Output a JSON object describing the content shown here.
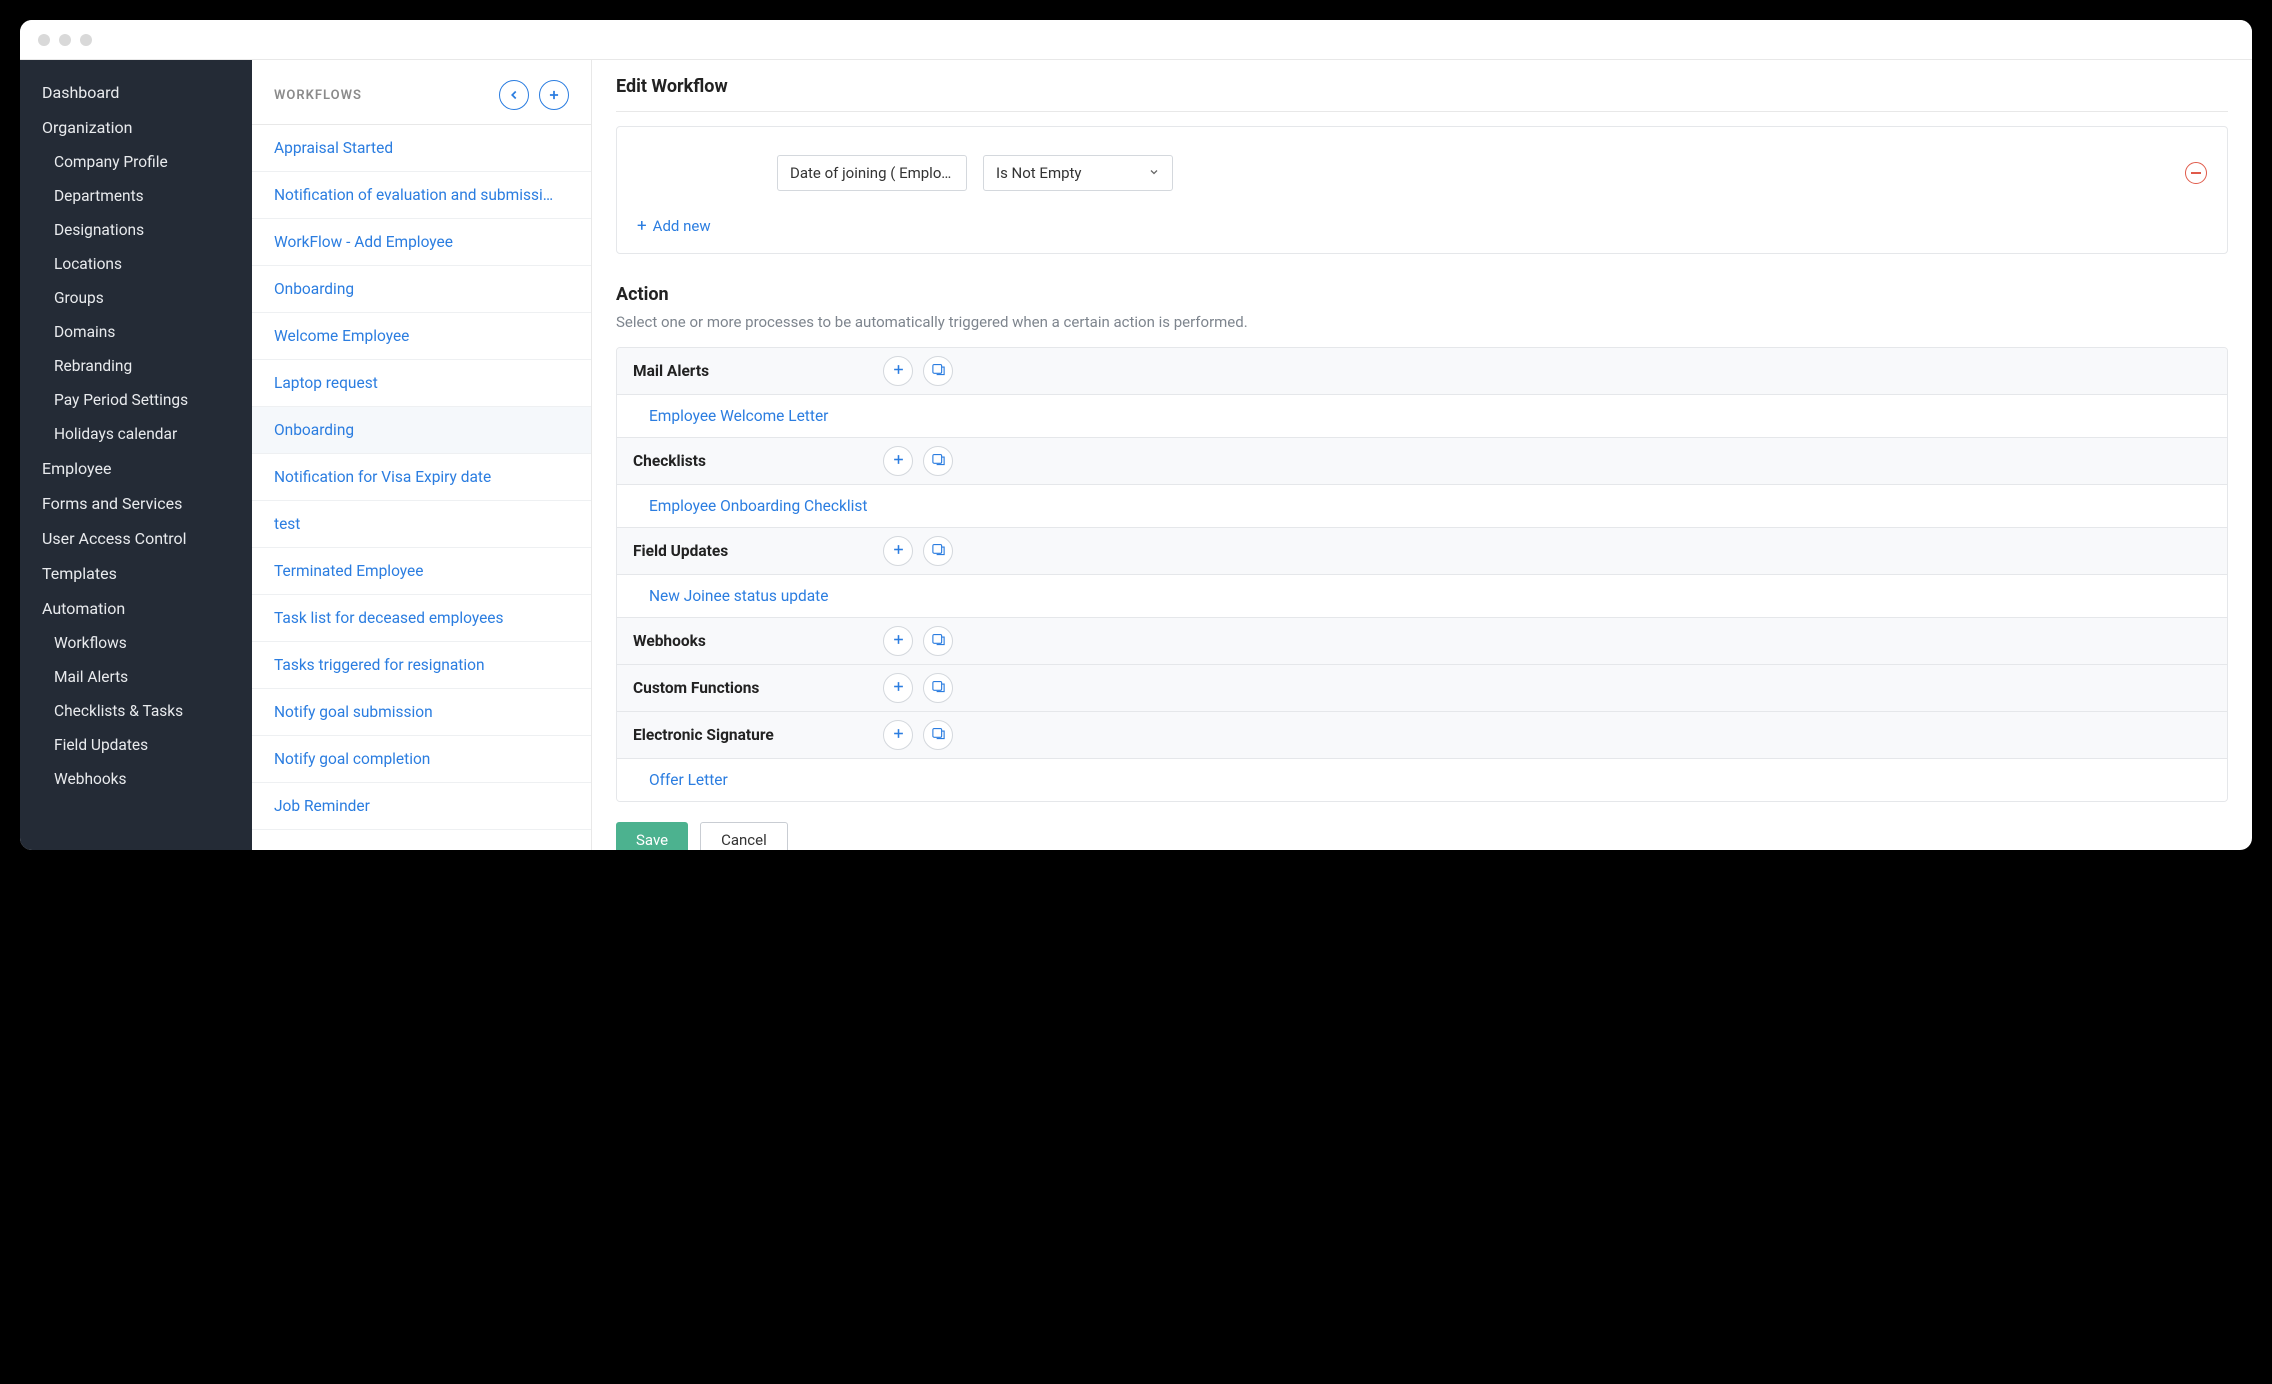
{
  "nav": {
    "items": [
      {
        "label": "Dashboard",
        "level": 0
      },
      {
        "label": "Organization",
        "level": 0
      },
      {
        "label": "Company Profile",
        "level": 1
      },
      {
        "label": "Departments",
        "level": 1
      },
      {
        "label": "Designations",
        "level": 1
      },
      {
        "label": "Locations",
        "level": 1
      },
      {
        "label": "Groups",
        "level": 1
      },
      {
        "label": "Domains",
        "level": 1
      },
      {
        "label": "Rebranding",
        "level": 1
      },
      {
        "label": "Pay Period Settings",
        "level": 1
      },
      {
        "label": "Holidays calendar",
        "level": 1
      },
      {
        "label": "Employee",
        "level": 0
      },
      {
        "label": "Forms and Services",
        "level": 0
      },
      {
        "label": "User Access Control",
        "level": 0
      },
      {
        "label": "Templates",
        "level": 0
      },
      {
        "label": "Automation",
        "level": 0
      },
      {
        "label": "Workflows",
        "level": 1
      },
      {
        "label": "Mail Alerts",
        "level": 1
      },
      {
        "label": "Checklists & Tasks",
        "level": 1
      },
      {
        "label": "Field Updates",
        "level": 1
      },
      {
        "label": "Webhooks",
        "level": 1
      }
    ]
  },
  "workflows": {
    "title": "WORKFLOWS",
    "items": [
      "Appraisal Started",
      "Notification of evaluation and submissi…",
      "WorkFlow - Add Employee",
      "Onboarding",
      "Welcome Employee",
      "Laptop request",
      "Onboarding",
      "Notification for Visa Expiry date",
      "test",
      "Terminated Employee",
      "Task list for deceased employees",
      "Tasks triggered for resignation",
      "Notify goal submission",
      "Notify goal completion",
      "Job Reminder"
    ],
    "active_index": 6
  },
  "main": {
    "title": "Edit Workflow",
    "criteria": {
      "field": "Date of joining ( Employe",
      "operator": "Is Not Empty",
      "add_label": "Add new"
    },
    "action": {
      "title": "Action",
      "desc": "Select one or more processes to be automatically triggered when a certain action is performed.",
      "groups": [
        {
          "title": "Mail Alerts",
          "items": [
            "Employee Welcome Letter"
          ]
        },
        {
          "title": "Checklists",
          "items": [
            "Employee Onboarding Checklist"
          ]
        },
        {
          "title": "Field Updates",
          "items": [
            "New Joinee status update"
          ]
        },
        {
          "title": "Webhooks",
          "items": []
        },
        {
          "title": "Custom Functions",
          "items": []
        },
        {
          "title": "Electronic Signature",
          "items": [
            "Offer Letter"
          ]
        }
      ]
    },
    "buttons": {
      "save": "Save",
      "cancel": "Cancel"
    }
  }
}
